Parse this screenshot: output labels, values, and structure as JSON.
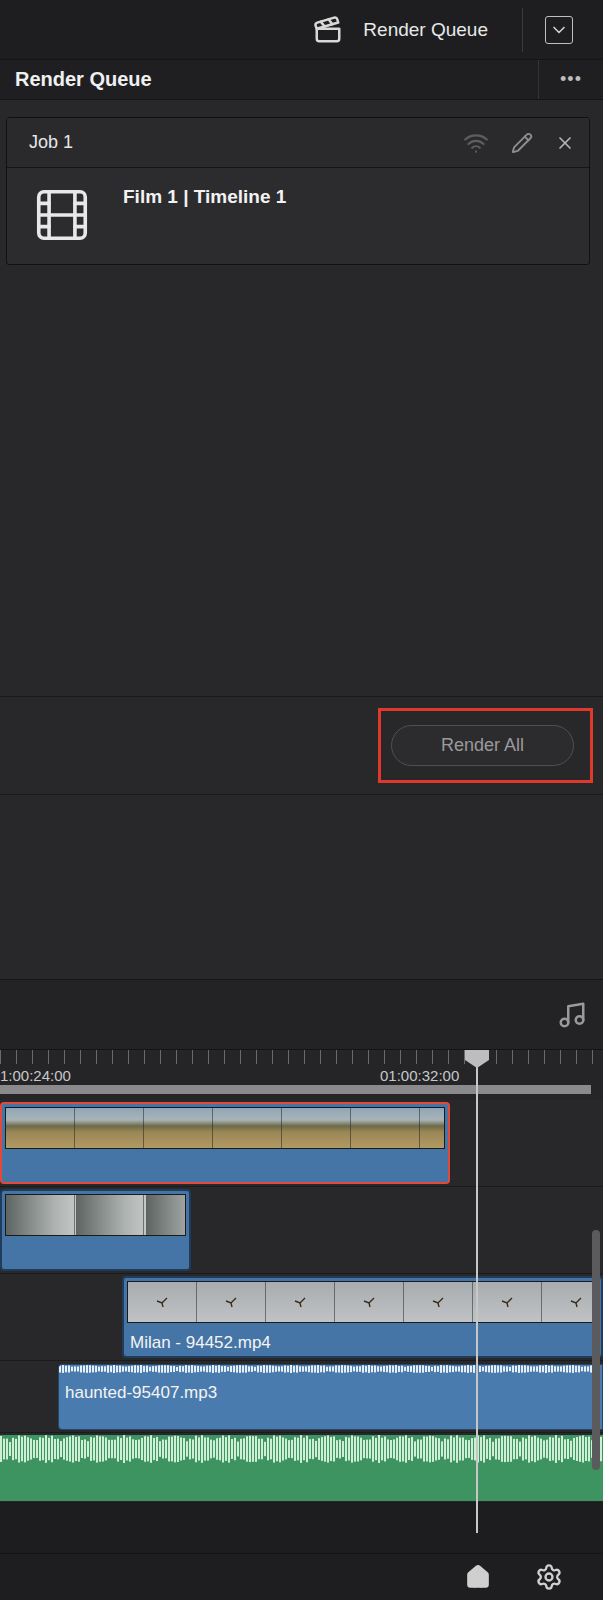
{
  "topbar": {
    "title": "Render Queue"
  },
  "panel": {
    "title": "Render Queue",
    "menu": "•••"
  },
  "jobs": [
    {
      "name": "Job 1",
      "description": "Film 1 | Timeline 1"
    }
  ],
  "render_button": {
    "label": "Render All",
    "highlighted": true
  },
  "timeline": {
    "ruler": [
      "1:00:24:00",
      "01:00:32:00"
    ],
    "tracks": [
      {
        "kind": "video",
        "clips": [
          {
            "label": "",
            "selected": true,
            "thumb": "landscape"
          }
        ]
      },
      {
        "kind": "video",
        "clips": [
          {
            "label": "",
            "selected": false,
            "thumb": "fog"
          }
        ]
      },
      {
        "kind": "video",
        "clips": [
          {
            "label": "Milan - 94452.mp4",
            "selected": false,
            "thumb": "sky"
          }
        ]
      },
      {
        "kind": "audio",
        "clips": [
          {
            "label": "haunted-95407.mp3",
            "selected": false
          }
        ]
      },
      {
        "kind": "music",
        "clips": [
          {
            "label": "",
            "selected": false
          }
        ]
      }
    ]
  }
}
